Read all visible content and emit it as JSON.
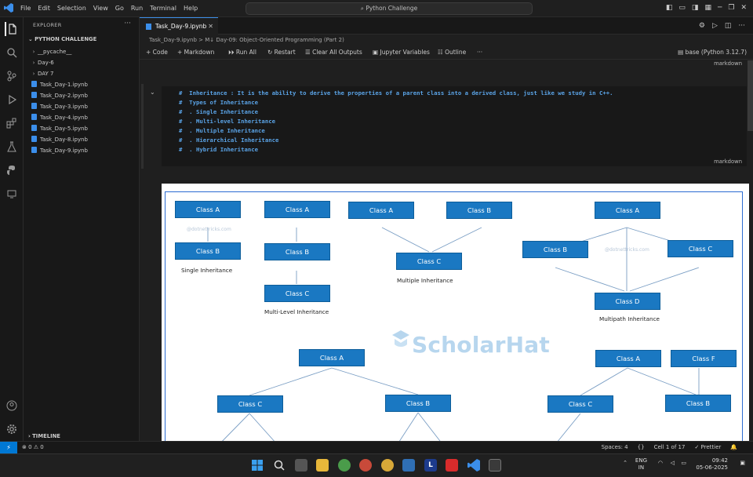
{
  "window": {
    "menu": [
      "File",
      "Edit",
      "Selection",
      "View",
      "Go",
      "Run",
      "Terminal",
      "Help"
    ],
    "search": "Python Challenge"
  },
  "sidebar": {
    "header": "EXPLORER",
    "section": "PYTHON CHALLENGE",
    "items": [
      {
        "label": "__pycache__",
        "kind": "folder"
      },
      {
        "label": "Day-6",
        "kind": "folder"
      },
      {
        "label": "DAY 7",
        "kind": "folder"
      },
      {
        "label": "Task_Day-1.ipynb",
        "kind": "file"
      },
      {
        "label": "Task_Day-2.ipynb",
        "kind": "file"
      },
      {
        "label": "Task_Day-3.ipynb",
        "kind": "file"
      },
      {
        "label": "Task_Day-4.ipynb",
        "kind": "file"
      },
      {
        "label": "Task_Day-5.ipynb",
        "kind": "file"
      },
      {
        "label": "Task_Day-8.ipynb",
        "kind": "file"
      },
      {
        "label": "Task_Day-9.ipynb",
        "kind": "file"
      }
    ],
    "timeline": "TIMELINE"
  },
  "editor": {
    "tab": "Task_Day-9.ipynb",
    "breadcrumb": {
      "file": "Task_Day-9.ipynb",
      "sep": ">",
      "md": "M↓",
      "section": "Day-09: Object-Oriented Programming (Part 2)"
    },
    "toolbar": {
      "code": "Code",
      "markdown": "Markdown",
      "run_all": "Run All",
      "restart": "Restart",
      "clear": "Clear All Outputs",
      "vars": "Jupyter Variables",
      "outline": "Outline",
      "more": "···",
      "kernel": "base (Python 3.12.7)"
    },
    "cell_type_label": "markdown",
    "md_lines": [
      "#  Inheritance : It is the ability to derive the properties of a parent class into a derived class, just like we study in C++.",
      "#  Types of Inheritance",
      "#  . Single Inheritance",
      "#  . Multi-level Inheritance",
      "#  . Multiple Inheritance",
      "#  . Hierarchical Inheritance",
      "#  . Hybrid Inheritance"
    ]
  },
  "diagram": {
    "class_a": "Class A",
    "class_b": "Class B",
    "class_c": "Class C",
    "class_d": "Class D",
    "class_f": "Class F",
    "single": "Single Inheritance",
    "multilevel": "Multi-Level Inheritance",
    "multiple": "Multiple Inheritance",
    "multipath": "Multipath Inheritance",
    "watermark": "@dotnettricks.com",
    "brand": "ScholarHat"
  },
  "status": {
    "remote": "⚡",
    "errors": "⊗ 0 ⚠ 0",
    "spaces": "Spaces: 4",
    "braces": "{}",
    "cell": "Cell 1 of 17",
    "prettier": "✓ Prettier",
    "bell": "🔔"
  },
  "tray": {
    "lang": "ENG",
    "region": "IN",
    "time": "09:42",
    "date": "05-06-2025"
  }
}
